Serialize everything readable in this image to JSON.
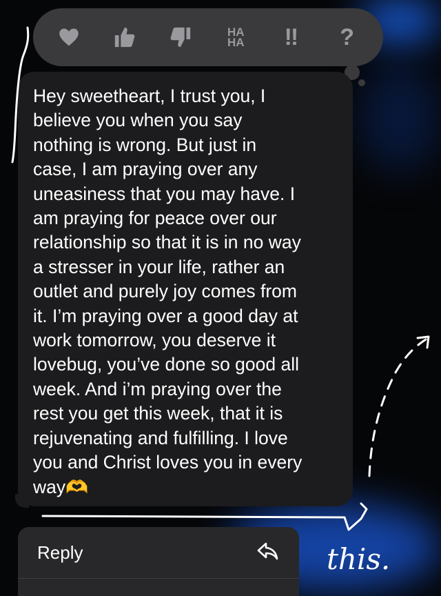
{
  "tapback": {
    "reactions": [
      {
        "icon": "heart-icon"
      },
      {
        "icon": "thumbs-up-icon"
      },
      {
        "icon": "thumbs-down-icon"
      },
      {
        "icon": "haha-icon",
        "line1": "HA",
        "line2": "HA"
      },
      {
        "icon": "exclamation-icon",
        "text": "‼"
      },
      {
        "icon": "question-icon",
        "text": "?"
      }
    ]
  },
  "message": {
    "text": "Hey sweetheart, I trust you, I\nbelieve you when you say\nnothing is wrong. But just in\ncase, I am praying over any\nuneasiness that you may have. I\nam praying for peace over our\nrelationship so that it is in no way\na stresser in your life, rather an\noutlet and purely joy comes from\nit. I’m praying over a good day at\nwork tomorrow, you deserve it\nlovebug, you’ve done so good all\nweek. And i’m praying over the\nrest you get this week, that it is\nrejuvenating and fulfilling. I love\nyou and Christ loves you in every\nway🫶"
  },
  "context_menu": {
    "reply_label": "Reply",
    "reply_icon": "reply-arrow-icon"
  },
  "annotation": {
    "caption": "this."
  },
  "colors": {
    "tapback_bg": "#3a3a3c",
    "bubble_bg": "#1c1c1e",
    "menu_bg": "#28282a",
    "glow": "#1e6cff"
  }
}
